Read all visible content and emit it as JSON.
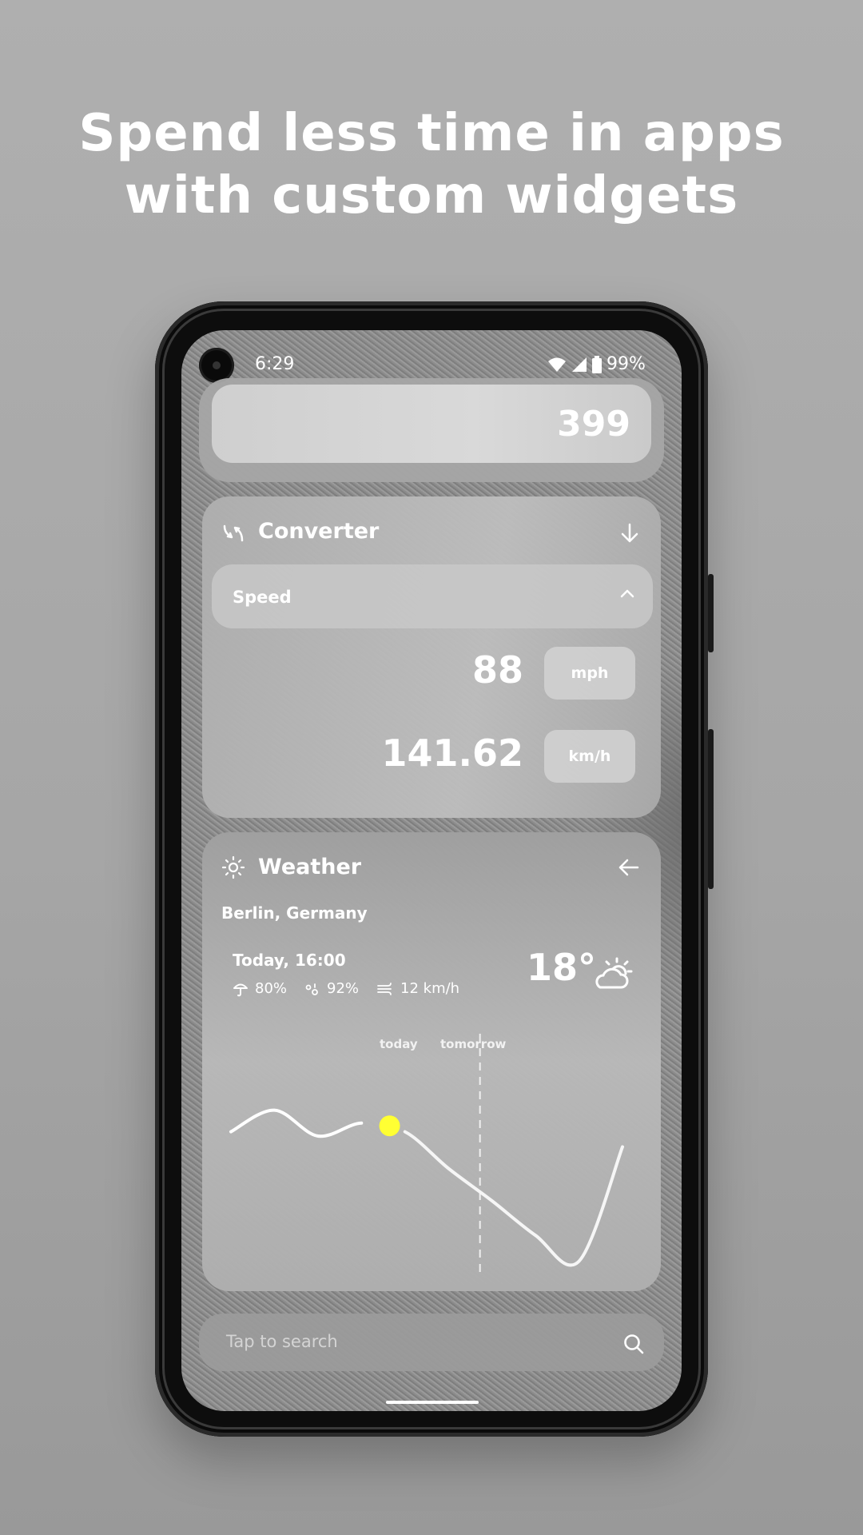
{
  "headline": {
    "line1": "Spend less time in apps",
    "line2": "with custom widgets"
  },
  "status_bar": {
    "time": "6:29",
    "battery": "99%",
    "icons": [
      "wifi-icon",
      "signal-icon",
      "battery-icon"
    ]
  },
  "counter_widget": {
    "value": "399"
  },
  "converter": {
    "title": "Converter",
    "icon": "swap-arrows-icon",
    "action_icon": "arrow-down-icon",
    "category": "Speed",
    "category_icon": "chevron-up-icon",
    "rows": [
      {
        "value": "88",
        "unit": "mph"
      },
      {
        "value": "141.62",
        "unit": "km/h"
      }
    ]
  },
  "weather": {
    "title": "Weather",
    "icon": "sun-icon",
    "action_icon": "arrow-left-icon",
    "location": "Berlin, Germany",
    "time_label": "Today, 16:00",
    "precipitation": "80%",
    "humidity": "92%",
    "wind": "12 km/h",
    "temperature": "18°",
    "condition_icon": "partly-cloudy-icon",
    "highlight_color": "#ffff33",
    "chart": {
      "label_today": "today",
      "label_tomorrow": "tomorrow",
      "relative_temps": [
        0.62,
        0.72,
        0.6,
        0.66,
        0.62,
        0.45,
        0.3,
        0.14,
        0.02,
        0.55
      ],
      "current_index": 4,
      "divider_index": 6
    }
  },
  "search": {
    "placeholder": "Tap to search",
    "icon": "search-icon"
  }
}
